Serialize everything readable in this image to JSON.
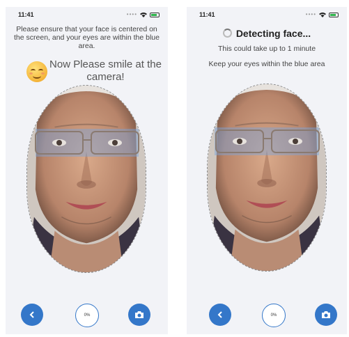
{
  "colors": {
    "accent": "#3477c9",
    "screen_bg": "#f2f3f7",
    "eye_band": "#78a5dc"
  },
  "left_screen": {
    "time": "11:41",
    "instruction": "Please ensure that your face is centered on the screen, and your eyes are within the blue area.",
    "smile_prompt": "Now Please smile at the camera!",
    "progress_label": "0%",
    "icons": [
      "smile-emoji-icon",
      "chevron-left-icon",
      "camera-icon",
      "wifi-icon",
      "battery-icon"
    ]
  },
  "right_screen": {
    "time": "11:41",
    "title": "Detecting face...",
    "subtitle": "This could take up to 1 minute",
    "eyes_instruction": "Keep your eyes within the blue area",
    "progress_label": "0%",
    "icons": [
      "spinner-icon",
      "chevron-left-icon",
      "camera-icon",
      "wifi-icon",
      "battery-icon"
    ]
  }
}
